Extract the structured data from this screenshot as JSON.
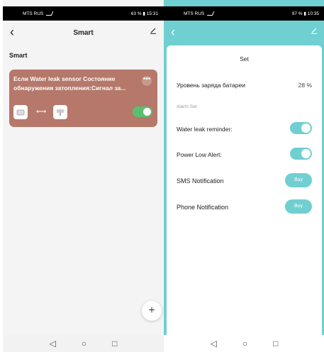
{
  "left_screen": {
    "status": {
      "carrier": "MTS RUS",
      "right": "63 % ▮ 15:31"
    },
    "appbar": {
      "title": "Smart"
    },
    "section_title": "Smart",
    "card": {
      "text": "Если Water leak sensor Состояние обнаружения затопления:Сигнал за...",
      "more": "•••",
      "arrow": "⟷",
      "enabled": true,
      "color": "#b5786a"
    },
    "fab": "+",
    "nav": {
      "back": "◁",
      "home": "○",
      "recent": "□"
    }
  },
  "right_screen": {
    "status": {
      "carrier": "MTS RUS",
      "right": "97 % ▮ 10:35"
    },
    "sheet": {
      "title": "Set",
      "battery_label": "Уровень заряда батареи",
      "battery_value": "28 %",
      "alarm_set_label": "Alarm Set",
      "water_leak_label": "Water leak reminder:",
      "water_leak_on": true,
      "power_low_label": "Power Low Alert:",
      "power_low_on": true,
      "sms_label": "SMS Notification",
      "sms_button": "Buy",
      "phone_label": "Phone Notification",
      "phone_button": "Buy"
    },
    "accent_color": "#6fcfd1",
    "nav": {
      "back": "◁",
      "home": "○",
      "recent": "□"
    }
  }
}
